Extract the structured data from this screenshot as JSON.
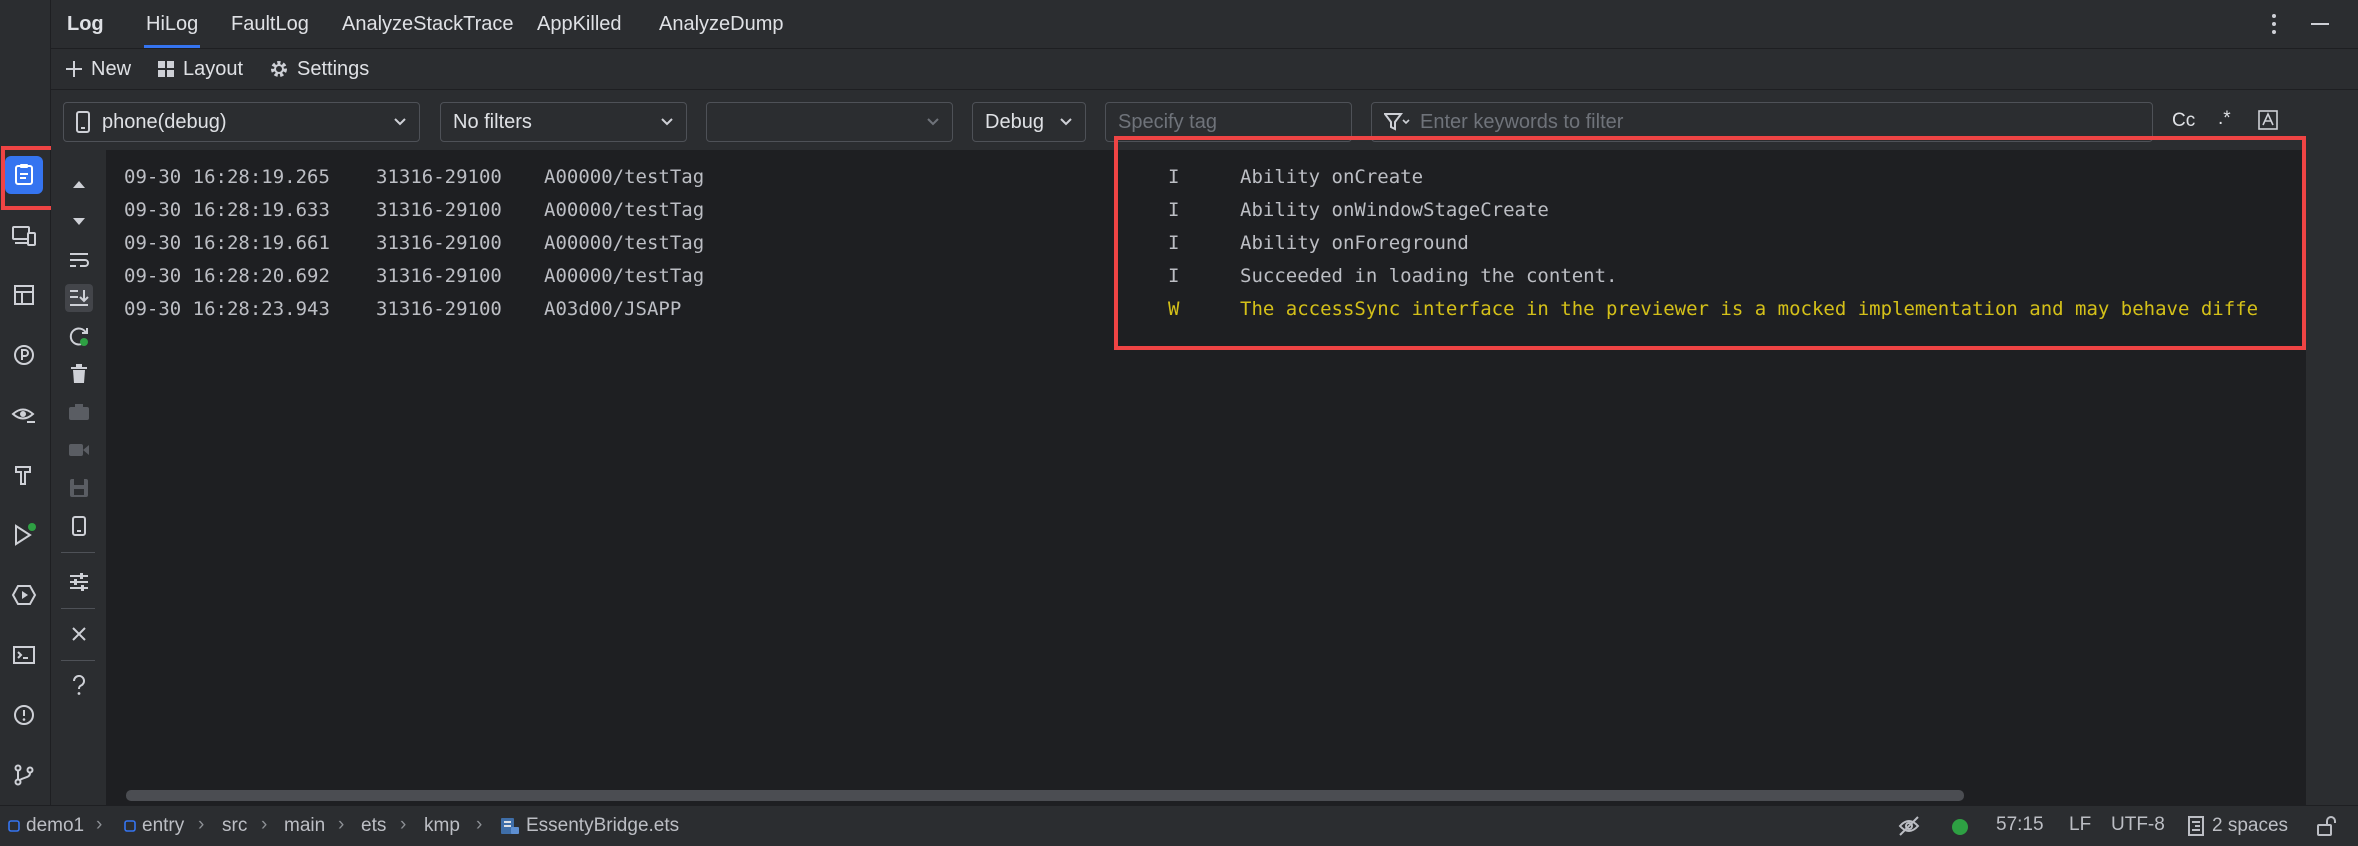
{
  "header": {
    "title": "Log",
    "tabs": [
      {
        "label": "HiLog",
        "selected": true
      },
      {
        "label": "FaultLog",
        "selected": false
      },
      {
        "label": "AnalyzeStackTrace",
        "selected": false
      },
      {
        "label": "AppKilled",
        "selected": false
      },
      {
        "label": "AnalyzeDump",
        "selected": false
      }
    ]
  },
  "toolbar": {
    "new_label": "New",
    "layout_label": "Layout",
    "settings_label": "Settings"
  },
  "filters": {
    "device": "phone(debug)",
    "filter_mode": "No filters",
    "process": "",
    "level": "Debug",
    "tag_placeholder": "Specify tag",
    "keyword_placeholder": "Enter keywords to filter",
    "case_label": "Cc",
    "regex_label": ".*"
  },
  "log": {
    "rows": [
      {
        "time": "09-30 16:28:19.265",
        "pid": "31316-29100",
        "tag": "A00000/testTag",
        "level": "I",
        "message": "Ability onCreate"
      },
      {
        "time": "09-30 16:28:19.633",
        "pid": "31316-29100",
        "tag": "A00000/testTag",
        "level": "I",
        "message": "Ability onWindowStageCreate"
      },
      {
        "time": "09-30 16:28:19.661",
        "pid": "31316-29100",
        "tag": "A00000/testTag",
        "level": "I",
        "message": "Ability onForeground"
      },
      {
        "time": "09-30 16:28:20.692",
        "pid": "31316-29100",
        "tag": "A00000/testTag",
        "level": "I",
        "message": "Succeeded in loading the content."
      },
      {
        "time": "09-30 16:28:23.943",
        "pid": "31316-29100",
        "tag": "A03d00/JSAPP",
        "level": "W",
        "message": "The accessSync interface in the previewer is a mocked implementation and may behave diffe"
      }
    ]
  },
  "breadcrumb": [
    "demo1",
    "entry",
    "src",
    "main",
    "ets",
    "kmp",
    "EssentyBridge.ets"
  ],
  "status": {
    "position": "57:15",
    "line_ending": "LF",
    "encoding": "UTF-8",
    "indent": "2 spaces"
  },
  "colors": {
    "accent": "#3574f0",
    "highlight": "#ef4444",
    "warn": "#d4c019",
    "status_ok": "#2ea043"
  }
}
